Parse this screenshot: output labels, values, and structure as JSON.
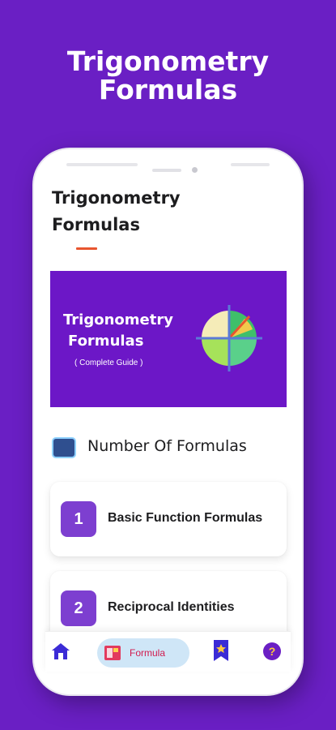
{
  "promo": {
    "title_line1": "Trigonometry",
    "title_line2": "Formulas"
  },
  "app": {
    "title_line1": "Trigonometry",
    "title_line2": "Formulas",
    "accent_color": "#e8552f"
  },
  "banner": {
    "title_line1": "Trigonometry",
    "title_line2": "Formulas",
    "subtitle": "Complete Guide",
    "background": "#6c17c7",
    "graphic_icon": "unit-circle-icon"
  },
  "section": {
    "icon": "formula-book-icon",
    "label": "Number Of Formulas"
  },
  "cards": [
    {
      "number": "1",
      "label": "Basic Function Formulas"
    },
    {
      "number": "2",
      "label": "Reciprocal Identities"
    }
  ],
  "nav": {
    "items": [
      {
        "icon": "home-icon",
        "label": ""
      },
      {
        "icon": "formula-icon",
        "label": "Formula",
        "active": true
      },
      {
        "icon": "bookmark-icon",
        "label": ""
      },
      {
        "icon": "help-icon",
        "label": ""
      }
    ],
    "active_color": "#d11b4e"
  },
  "colors": {
    "background": "#6a1fc4",
    "card_number": "#7d3fd0"
  }
}
